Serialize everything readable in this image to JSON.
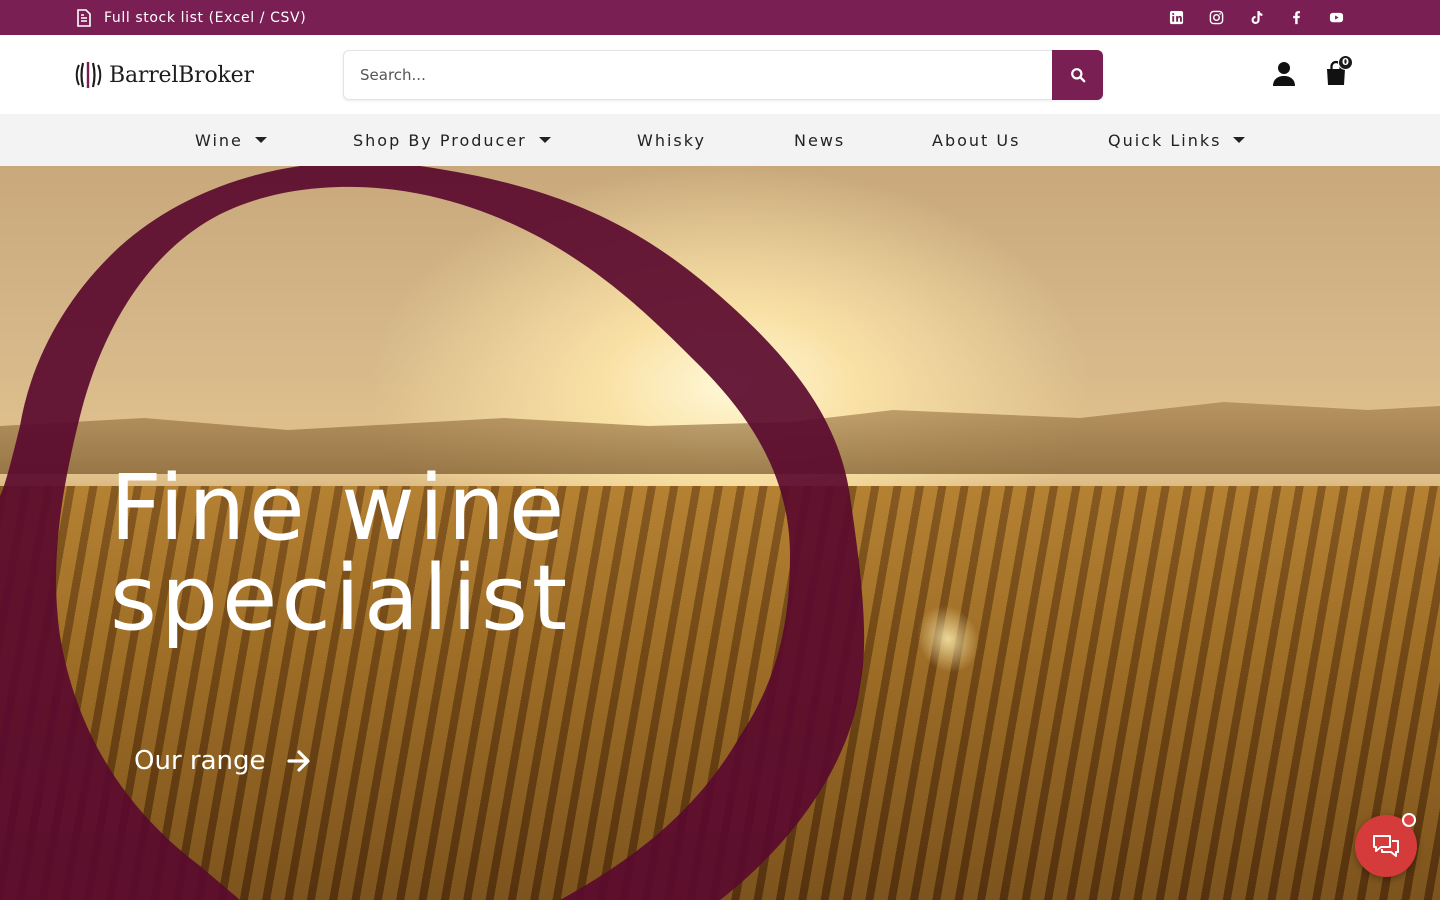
{
  "topbar": {
    "stock_link": "Full stock list (Excel / CSV)",
    "stock_icon": "file-icon",
    "socials": [
      "linkedin-icon",
      "instagram-icon",
      "tiktok-icon",
      "facebook-icon",
      "youtube-icon"
    ]
  },
  "header": {
    "logo_text": "BarrelBroker",
    "search_placeholder": "Search...",
    "cart_count": "0"
  },
  "nav": {
    "items": [
      {
        "label": "Wine",
        "dropdown": true
      },
      {
        "label": "Shop By Producer",
        "dropdown": true
      },
      {
        "label": "Whisky",
        "dropdown": false
      },
      {
        "label": "News",
        "dropdown": false
      },
      {
        "label": "About Us",
        "dropdown": false
      },
      {
        "label": "Quick Links",
        "dropdown": true
      }
    ]
  },
  "hero": {
    "title_line1": "Fine wine",
    "title_line2": "specialist",
    "cta_label": "Our range"
  },
  "colors": {
    "brand": "#7a1f54",
    "ring": "#5a0a2e",
    "chat": "#d63b3b"
  }
}
